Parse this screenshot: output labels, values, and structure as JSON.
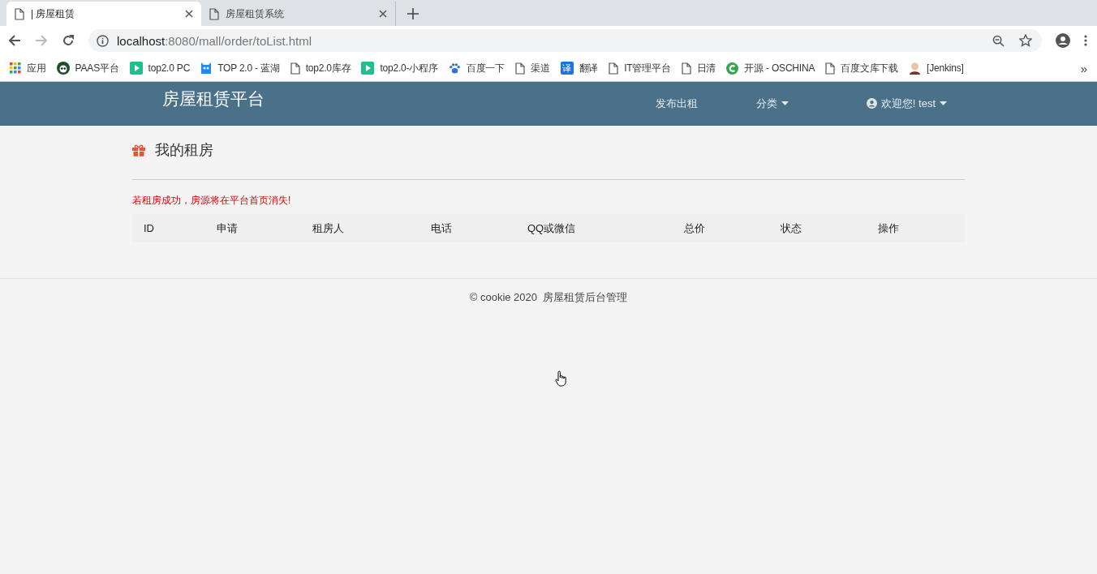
{
  "browser": {
    "tabs": [
      {
        "title": "| 房屋租赁",
        "selected": true
      },
      {
        "title": "房屋租赁系统",
        "selected": false
      }
    ],
    "address": {
      "host": "localhost",
      "path": ":8080/mall/order/toList.html"
    },
    "bookmarks": [
      {
        "kind": "apps",
        "label": "应用"
      },
      {
        "kind": "panda",
        "label": "PAAS平台"
      },
      {
        "kind": "play",
        "label": "top2.0 PC"
      },
      {
        "kind": "mascot",
        "label": "TOP 2.0 - 蓝湖"
      },
      {
        "kind": "page",
        "label": "top2.0库存"
      },
      {
        "kind": "play",
        "label": "top2.0-小程序"
      },
      {
        "kind": "paw",
        "label": "百度一下"
      },
      {
        "kind": "page",
        "label": "渠道"
      },
      {
        "kind": "translate",
        "label": "翻译",
        "glyph": "译"
      },
      {
        "kind": "page",
        "label": "IT管理平台"
      },
      {
        "kind": "page",
        "label": "日清"
      },
      {
        "kind": "c",
        "label": "开源 - OSCHINA"
      },
      {
        "kind": "page",
        "label": "百度文库下载"
      },
      {
        "kind": "avatar",
        "label": "[Jenkins]"
      }
    ],
    "more": "»"
  },
  "navbar": {
    "brand": "房屋租赁平台",
    "links": [
      {
        "label": "发布出租",
        "dropdown": false,
        "user": false
      },
      {
        "label": "分类",
        "dropdown": true,
        "user": false
      },
      {
        "label": "欢迎您! test",
        "dropdown": true,
        "user": true
      }
    ]
  },
  "page": {
    "title": "我的租房",
    "notice": "若租房成功，房源将在平台首页消失!",
    "table": {
      "columns": [
        "ID",
        "申请",
        "租房人",
        "电话",
        "QQ或微信",
        "总价",
        "状态",
        "操作"
      ]
    }
  },
  "footer": {
    "copyright": "© cookie 2020",
    "text": "房屋租赁后台管理"
  }
}
